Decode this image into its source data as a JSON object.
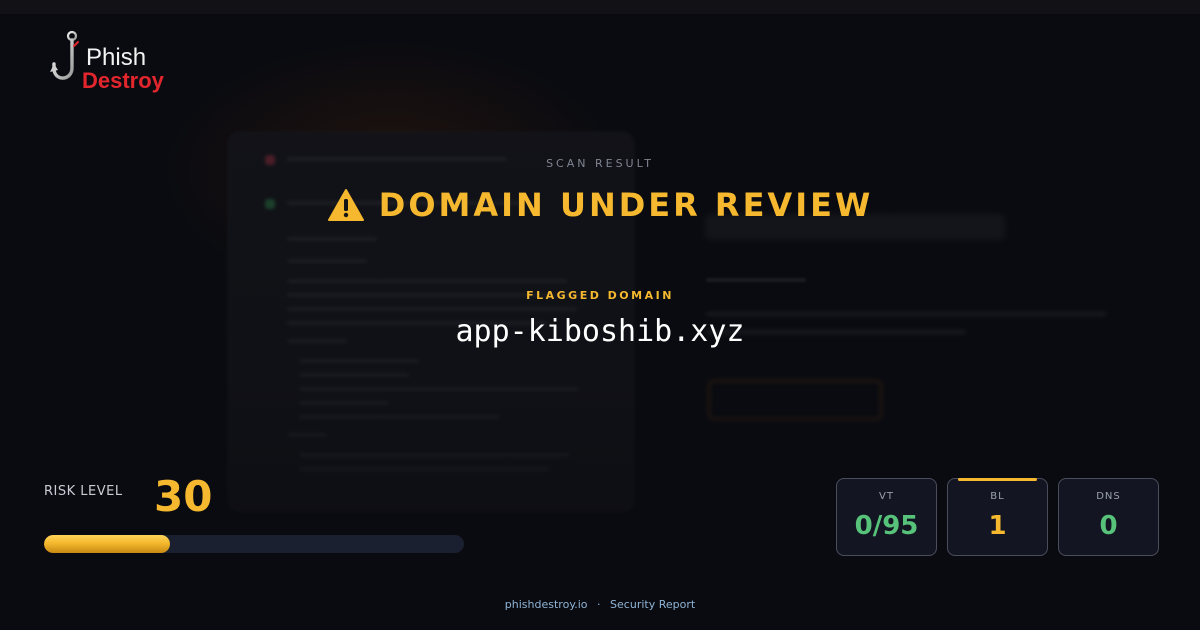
{
  "brand": {
    "name_top": "Phish",
    "name_bottom": "Destroy",
    "primary_color": "#e3262d"
  },
  "scan": {
    "eyebrow": "SCAN RESULT",
    "status_icon": "warning-triangle-icon",
    "status_title": "DOMAIN UNDER REVIEW",
    "status_color": "#f5b82e"
  },
  "flagged": {
    "label": "FLAGGED DOMAIN",
    "domain": "app-kiboshib.xyz"
  },
  "risk": {
    "label": "RISK LEVEL",
    "value": "30",
    "percent": 30
  },
  "stats": [
    {
      "label": "VT",
      "value": "0/95",
      "color": "#57c27a",
      "accent": ""
    },
    {
      "label": "BL",
      "value": "1",
      "color": "#f5b82e",
      "accent": "#f5b82e"
    },
    {
      "label": "DNS",
      "value": "0",
      "color": "#57c27a",
      "accent": ""
    }
  ],
  "footer": {
    "site": "phishdestroy.io",
    "separator": "·",
    "report": "Security Report"
  }
}
